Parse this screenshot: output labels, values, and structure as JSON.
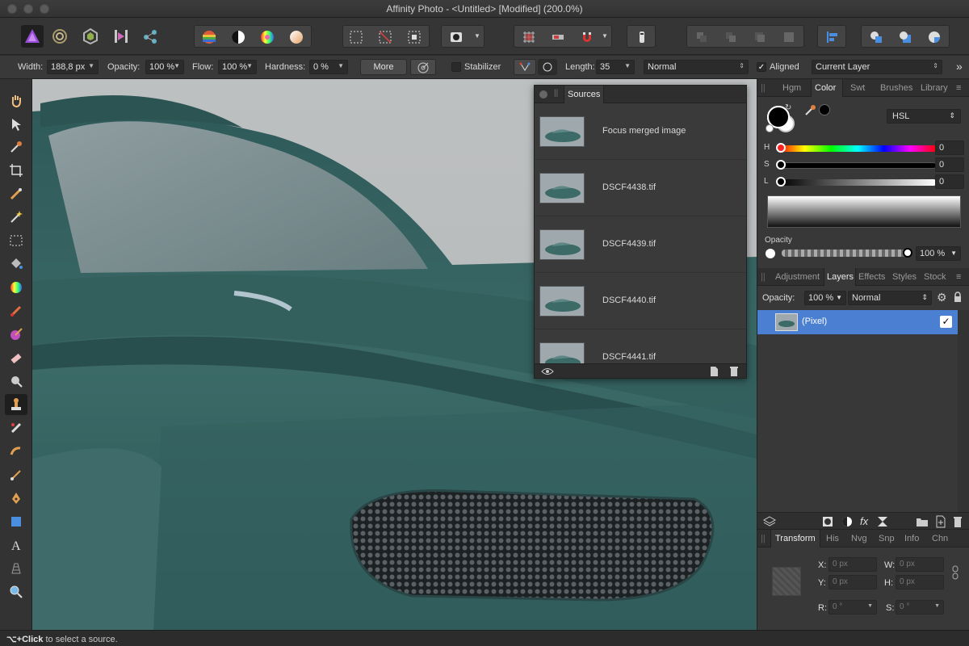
{
  "window": {
    "title": "Affinity Photo - <Untitled> [Modified] (200.0%)"
  },
  "toolbar": {
    "personas": [
      "photo-persona",
      "liquify-persona",
      "develop-persona",
      "tone-mapping-persona",
      "export-persona"
    ]
  },
  "context": {
    "width_label": "Width:",
    "width_value": "188,8 px",
    "opacity_label": "Opacity:",
    "opacity_value": "100 %",
    "flow_label": "Flow:",
    "flow_value": "100 %",
    "hardness_label": "Hardness:",
    "hardness_value": "0 %",
    "more_label": "More",
    "stabilizer_label": "Stabilizer",
    "length_label": "Length:",
    "length_value": "35",
    "blend_mode": "Normal",
    "aligned_label": "Aligned",
    "source_layer": "Current Layer"
  },
  "sources_panel": {
    "tab": "Sources",
    "items": [
      {
        "name": "Focus merged image"
      },
      {
        "name": "DSCF4438.tif"
      },
      {
        "name": "DSCF4439.tif"
      },
      {
        "name": "DSCF4440.tif"
      },
      {
        "name": "DSCF4441.tif"
      }
    ]
  },
  "color_panel": {
    "tabs": [
      "Hgm",
      "Color",
      "Swt",
      "Brushes",
      "Library"
    ],
    "active_tab": "Color",
    "model": "HSL",
    "h_label": "H",
    "h_value": "0",
    "s_label": "S",
    "s_value": "0",
    "l_label": "L",
    "l_value": "0",
    "opacity_label": "Opacity",
    "opacity_value": "100 %",
    "opacity_level": 1.0
  },
  "layers_panel": {
    "tabs": [
      "Adjustment",
      "Layers",
      "Effects",
      "Styles",
      "Stock"
    ],
    "active_tab": "Layers",
    "opacity_label": "Opacity:",
    "opacity_value": "100 %",
    "blend_mode": "Normal",
    "layer_name": "(Pixel)",
    "fx_label": "fx"
  },
  "transform_panel": {
    "tabs": [
      "Transform",
      "His",
      "Nvg",
      "Snp",
      "Info",
      "Chn"
    ],
    "active_tab": "Transform",
    "x_label": "X:",
    "x_value": "0 px",
    "y_label": "Y:",
    "y_value": "0 px",
    "w_label": "W:",
    "w_value": "0 px",
    "h_label": "H:",
    "h_value": "0 px",
    "r_label": "R:",
    "r_value": "0 °",
    "s_label": "S:",
    "s_value": "0 °"
  },
  "status": {
    "shortcut": "⌥+Click",
    "message": " to select a source."
  },
  "colors": {
    "accent": "#4a7fd1",
    "car_teal": "#3d6f6c",
    "background_gray": "#b9bcbd"
  }
}
